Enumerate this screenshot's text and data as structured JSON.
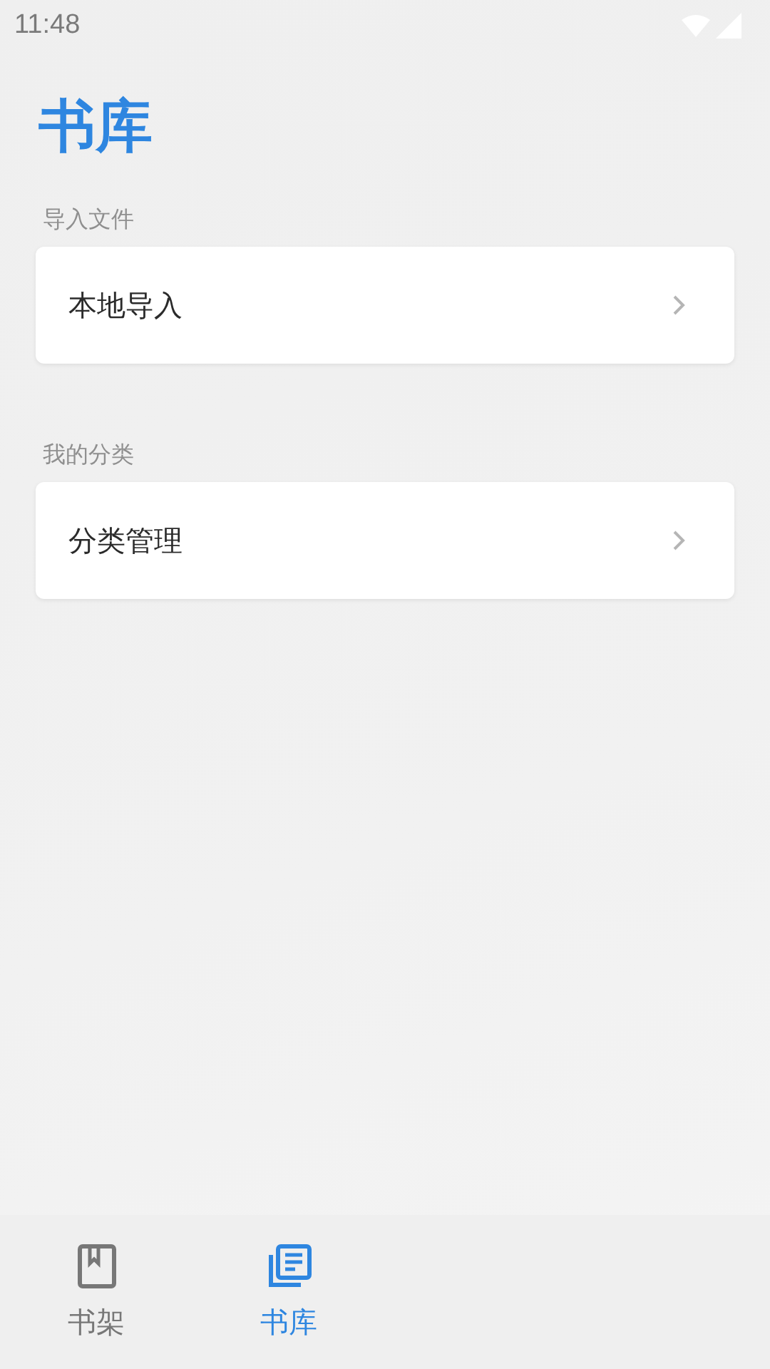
{
  "status_bar": {
    "time": "11:48"
  },
  "title": "书库",
  "sections": [
    {
      "heading": "导入文件",
      "items": [
        {
          "label": "本地导入"
        }
      ]
    },
    {
      "heading": "我的分类",
      "items": [
        {
          "label": "分类管理"
        }
      ]
    }
  ],
  "tabs": [
    {
      "label": "书架",
      "kind": "shelf",
      "selected": false
    },
    {
      "label": "书库",
      "kind": "library",
      "selected": true
    }
  ]
}
